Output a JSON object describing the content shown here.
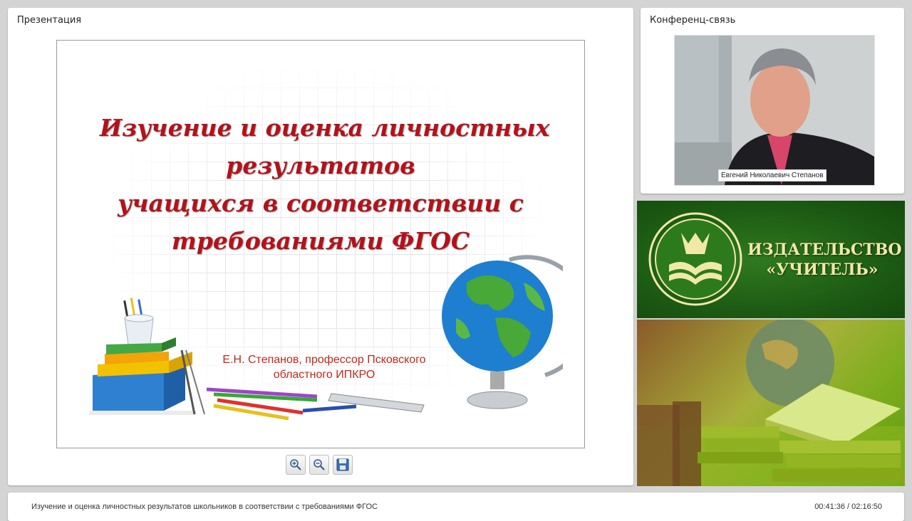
{
  "presentation_panel": {
    "title": "Презентация",
    "slide": {
      "title_lines": [
        "Изучение и оценка личностных",
        "результатов",
        "учащихся в соответствии с",
        "требованиями ФГОС"
      ],
      "author_lines": [
        "Е.Н. Степанов, профессор Псковского",
        "областного ИПКРО"
      ]
    },
    "controls": [
      {
        "name": "zoom-in",
        "icon": "zoom-in-icon"
      },
      {
        "name": "zoom-out",
        "icon": "zoom-out-icon"
      },
      {
        "name": "save",
        "icon": "save-icon"
      }
    ]
  },
  "conference_panel": {
    "title": "Конференц-связь",
    "speaker_name": "Евгений Николаевич Степанов"
  },
  "publisher": {
    "name_lines": [
      "ИЗДАТЕЛЬСТВО",
      "«УЧИТЕЛЬ»"
    ]
  },
  "status": {
    "title": "Изучение и оценка личностных результатов школьников в соответствии с требованиями ФГОС",
    "time": "00:41:36 / 02:16:50"
  },
  "colors": {
    "slide_title": "#b3121a",
    "logo_green": "#1d5c14",
    "logo_text": "#f1e8a8"
  }
}
